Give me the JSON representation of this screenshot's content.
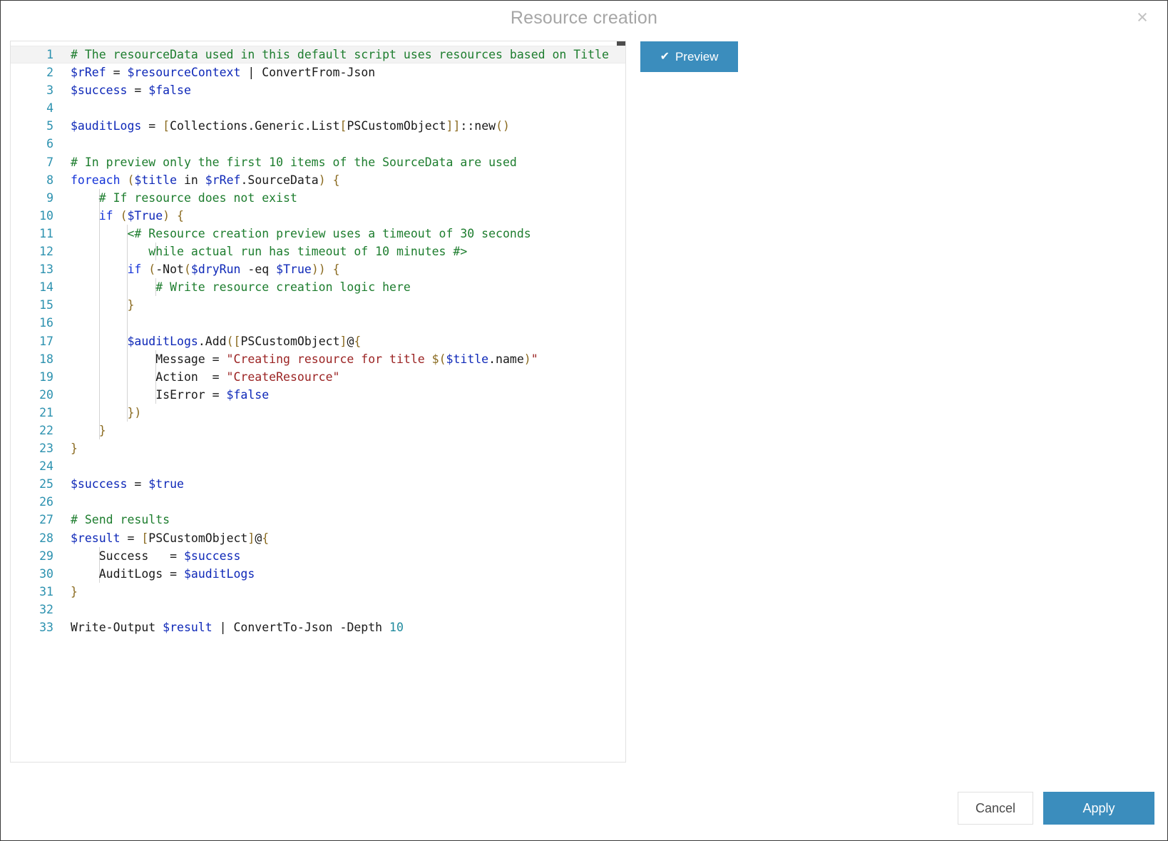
{
  "dialog": {
    "title": "Resource creation",
    "close_label": "×",
    "close_icon": "close-icon"
  },
  "toolbar": {
    "preview_label": "Preview",
    "preview_icon": "check-icon",
    "accent_color": "#3b8dbd"
  },
  "footer": {
    "cancel_label": "Cancel",
    "apply_label": "Apply"
  },
  "editor": {
    "language": "powershell",
    "active_line": 1,
    "total_lines": 33,
    "colors": {
      "comment": "#1d7d2e",
      "variable": "#0e28b8",
      "keyword": "#1433d8",
      "string": "#9b2323",
      "number": "#1f8a9e",
      "bracket": "#8a6a1f",
      "plain": "#1a1a1a",
      "line_number": "#2b91af",
      "active_line_bg": "#f3f3f3"
    },
    "lines": [
      {
        "n": 1,
        "tokens": [
          {
            "t": "# The resourceData used in this default script uses resources based on Title",
            "c": "cm"
          }
        ]
      },
      {
        "n": 2,
        "tokens": [
          {
            "t": "$rRef",
            "c": "va"
          },
          {
            "t": " = ",
            "c": "op"
          },
          {
            "t": "$resourceContext",
            "c": "va"
          },
          {
            "t": " | ",
            "c": "op"
          },
          {
            "t": "ConvertFrom-Json",
            "c": "tp"
          }
        ]
      },
      {
        "n": 3,
        "tokens": [
          {
            "t": "$success",
            "c": "va"
          },
          {
            "t": " = ",
            "c": "op"
          },
          {
            "t": "$false",
            "c": "va"
          }
        ]
      },
      {
        "n": 4,
        "tokens": []
      },
      {
        "n": 5,
        "tokens": [
          {
            "t": "$auditLogs",
            "c": "va"
          },
          {
            "t": " = ",
            "c": "op"
          },
          {
            "t": "[",
            "c": "br"
          },
          {
            "t": "Collections.Generic.List",
            "c": "tp"
          },
          {
            "t": "[",
            "c": "br"
          },
          {
            "t": "PSCustomObject",
            "c": "tp"
          },
          {
            "t": "]]",
            "c": "br"
          },
          {
            "t": "::new",
            "c": "tp"
          },
          {
            "t": "()",
            "c": "br"
          }
        ]
      },
      {
        "n": 6,
        "tokens": []
      },
      {
        "n": 7,
        "tokens": [
          {
            "t": "# In preview only the first 10 items of the SourceData are used",
            "c": "cm"
          }
        ]
      },
      {
        "n": 8,
        "tokens": [
          {
            "t": "foreach",
            "c": "kw"
          },
          {
            "t": " ",
            "c": "op"
          },
          {
            "t": "(",
            "c": "br"
          },
          {
            "t": "$title",
            "c": "va"
          },
          {
            "t": " in ",
            "c": "op"
          },
          {
            "t": "$rRef",
            "c": "va"
          },
          {
            "t": ".SourceData",
            "c": "tp"
          },
          {
            "t": ")",
            "c": "br"
          },
          {
            "t": " ",
            "c": "op"
          },
          {
            "t": "{",
            "c": "br"
          }
        ]
      },
      {
        "n": 9,
        "tokens": [
          {
            "t": "    # If resource does not exist",
            "c": "cm"
          }
        ]
      },
      {
        "n": 10,
        "tokens": [
          {
            "t": "    ",
            "c": "op"
          },
          {
            "t": "if",
            "c": "kw"
          },
          {
            "t": " ",
            "c": "op"
          },
          {
            "t": "(",
            "c": "br"
          },
          {
            "t": "$True",
            "c": "va"
          },
          {
            "t": ")",
            "c": "br"
          },
          {
            "t": " ",
            "c": "op"
          },
          {
            "t": "{",
            "c": "br"
          }
        ]
      },
      {
        "n": 11,
        "tokens": [
          {
            "t": "        <# Resource creation preview uses a timeout of 30 seconds",
            "c": "cm"
          }
        ]
      },
      {
        "n": 12,
        "tokens": [
          {
            "t": "           while actual run has timeout of 10 minutes #>",
            "c": "cm"
          }
        ]
      },
      {
        "n": 13,
        "tokens": [
          {
            "t": "        ",
            "c": "op"
          },
          {
            "t": "if",
            "c": "kw"
          },
          {
            "t": " ",
            "c": "op"
          },
          {
            "t": "(",
            "c": "br"
          },
          {
            "t": "-Not",
            "c": "tp"
          },
          {
            "t": "(",
            "c": "br"
          },
          {
            "t": "$dryRun",
            "c": "va"
          },
          {
            "t": " -eq ",
            "c": "op"
          },
          {
            "t": "$True",
            "c": "va"
          },
          {
            "t": "))",
            "c": "br"
          },
          {
            "t": " ",
            "c": "op"
          },
          {
            "t": "{",
            "c": "br"
          }
        ]
      },
      {
        "n": 14,
        "tokens": [
          {
            "t": "            # Write resource creation logic here",
            "c": "cm"
          }
        ]
      },
      {
        "n": 15,
        "tokens": [
          {
            "t": "        ",
            "c": "op"
          },
          {
            "t": "}",
            "c": "br"
          }
        ]
      },
      {
        "n": 16,
        "tokens": []
      },
      {
        "n": 17,
        "tokens": [
          {
            "t": "        ",
            "c": "op"
          },
          {
            "t": "$auditLogs",
            "c": "va"
          },
          {
            "t": ".Add",
            "c": "tp"
          },
          {
            "t": "(",
            "c": "br"
          },
          {
            "t": "[",
            "c": "br"
          },
          {
            "t": "PSCustomObject",
            "c": "tp"
          },
          {
            "t": "]",
            "c": "br"
          },
          {
            "t": "@",
            "c": "tp"
          },
          {
            "t": "{",
            "c": "br"
          }
        ]
      },
      {
        "n": 18,
        "tokens": [
          {
            "t": "            Message = ",
            "c": "op"
          },
          {
            "t": "\"Creating resource for title ",
            "c": "st"
          },
          {
            "t": "$(",
            "c": "br"
          },
          {
            "t": "$title",
            "c": "va"
          },
          {
            "t": ".name",
            "c": "tp"
          },
          {
            "t": ")",
            "c": "br"
          },
          {
            "t": "\"",
            "c": "st"
          }
        ]
      },
      {
        "n": 19,
        "tokens": [
          {
            "t": "            Action  = ",
            "c": "op"
          },
          {
            "t": "\"CreateResource\"",
            "c": "st"
          }
        ]
      },
      {
        "n": 20,
        "tokens": [
          {
            "t": "            IsError = ",
            "c": "op"
          },
          {
            "t": "$false",
            "c": "va"
          }
        ]
      },
      {
        "n": 21,
        "tokens": [
          {
            "t": "        ",
            "c": "op"
          },
          {
            "t": "})",
            "c": "br"
          }
        ]
      },
      {
        "n": 22,
        "tokens": [
          {
            "t": "    ",
            "c": "op"
          },
          {
            "t": "}",
            "c": "br"
          }
        ]
      },
      {
        "n": 23,
        "tokens": [
          {
            "t": "}",
            "c": "br"
          }
        ]
      },
      {
        "n": 24,
        "tokens": []
      },
      {
        "n": 25,
        "tokens": [
          {
            "t": "$success",
            "c": "va"
          },
          {
            "t": " = ",
            "c": "op"
          },
          {
            "t": "$true",
            "c": "va"
          }
        ]
      },
      {
        "n": 26,
        "tokens": []
      },
      {
        "n": 27,
        "tokens": [
          {
            "t": "# Send results",
            "c": "cm"
          }
        ]
      },
      {
        "n": 28,
        "tokens": [
          {
            "t": "$result",
            "c": "va"
          },
          {
            "t": " = ",
            "c": "op"
          },
          {
            "t": "[",
            "c": "br"
          },
          {
            "t": "PSCustomObject",
            "c": "tp"
          },
          {
            "t": "]",
            "c": "br"
          },
          {
            "t": "@",
            "c": "tp"
          },
          {
            "t": "{",
            "c": "br"
          }
        ]
      },
      {
        "n": 29,
        "tokens": [
          {
            "t": "    Success   = ",
            "c": "op"
          },
          {
            "t": "$success",
            "c": "va"
          }
        ]
      },
      {
        "n": 30,
        "tokens": [
          {
            "t": "    AuditLogs = ",
            "c": "op"
          },
          {
            "t": "$auditLogs",
            "c": "va"
          }
        ]
      },
      {
        "n": 31,
        "tokens": [
          {
            "t": "}",
            "c": "br"
          }
        ]
      },
      {
        "n": 32,
        "tokens": []
      },
      {
        "n": 33,
        "tokens": [
          {
            "t": "Write-Output ",
            "c": "tp"
          },
          {
            "t": "$result",
            "c": "va"
          },
          {
            "t": " | ",
            "c": "op"
          },
          {
            "t": "ConvertTo-Json -Depth ",
            "c": "tp"
          },
          {
            "t": "10",
            "c": "nu"
          }
        ]
      }
    ],
    "indent_guides": [
      {
        "col": 4,
        "from": 9,
        "to": 22
      },
      {
        "col": 8,
        "from": 11,
        "to": 21
      },
      {
        "col": 12,
        "from": 12,
        "to": 12
      },
      {
        "col": 12,
        "from": 14,
        "to": 14
      },
      {
        "col": 12,
        "from": 18,
        "to": 20
      },
      {
        "col": 4,
        "from": 29,
        "to": 30
      }
    ]
  }
}
